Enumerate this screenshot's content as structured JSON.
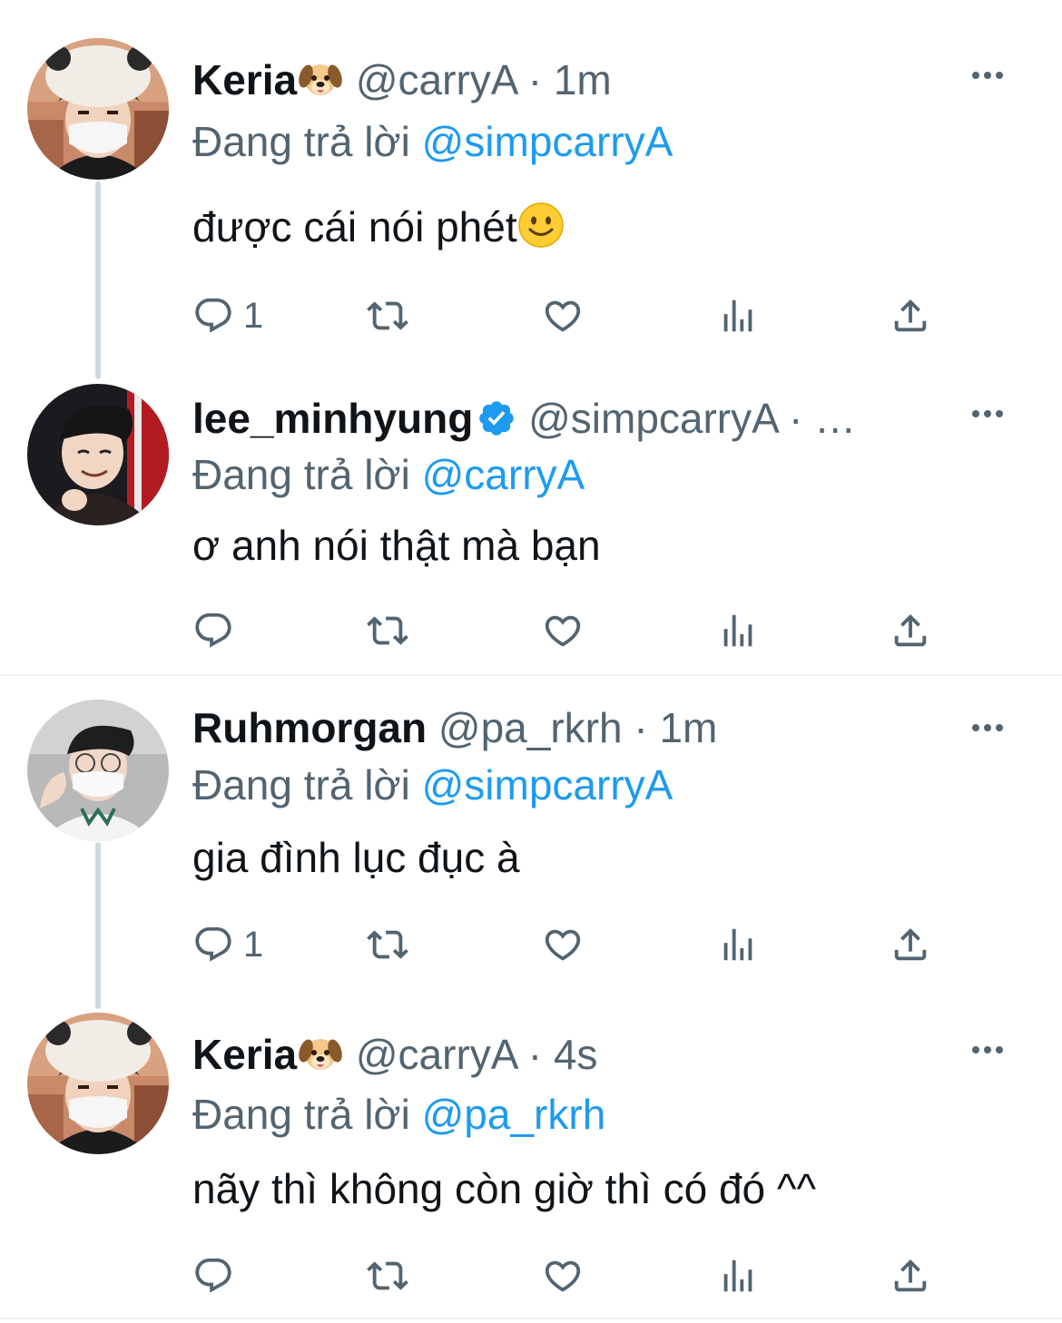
{
  "colors": {
    "text": "#0f1419",
    "secondary": "#536471",
    "link": "#1d9bf0",
    "thread_line": "#cfd9de",
    "divider": "#eff3f4"
  },
  "tweets": [
    {
      "name": "Keria",
      "name_emoji": "dog-face-emoji",
      "handle": "@carryA",
      "sep": " · ",
      "time": "1m",
      "reply_prefix": "Đang trả lời ",
      "reply_to": "@simpcarryA",
      "text": "được cái nói phét",
      "text_emoji": "slightly-smiling-face-emoji",
      "reply_count": "1",
      "avatar": "keria-avatar"
    },
    {
      "name": "lee_minhyung",
      "verified": true,
      "handle": "@simpcarryA",
      "sep": " · …",
      "reply_prefix": "Đang trả lời ",
      "reply_to": "@carryA",
      "text": "ơ anh nói thật mà bạn",
      "reply_count": "",
      "avatar": "minhyung-avatar"
    },
    {
      "name": "Ruhmorgan",
      "handle": "@pa_rkrh",
      "sep": " · ",
      "time": "1m",
      "reply_prefix": "Đang trả lời ",
      "reply_to": "@simpcarryA",
      "text": "gia đình lục đục à",
      "reply_count": "1",
      "avatar": "ruhmorgan-avatar"
    },
    {
      "name": "Keria",
      "name_emoji": "dog-face-emoji",
      "handle": "@carryA",
      "sep": " · ",
      "time": "4s",
      "reply_prefix": "Đang trả lời ",
      "reply_to": "@pa_rkrh",
      "text": "nãy thì không còn giờ thì có đó ^^",
      "reply_count": "",
      "avatar": "keria-avatar"
    }
  ]
}
